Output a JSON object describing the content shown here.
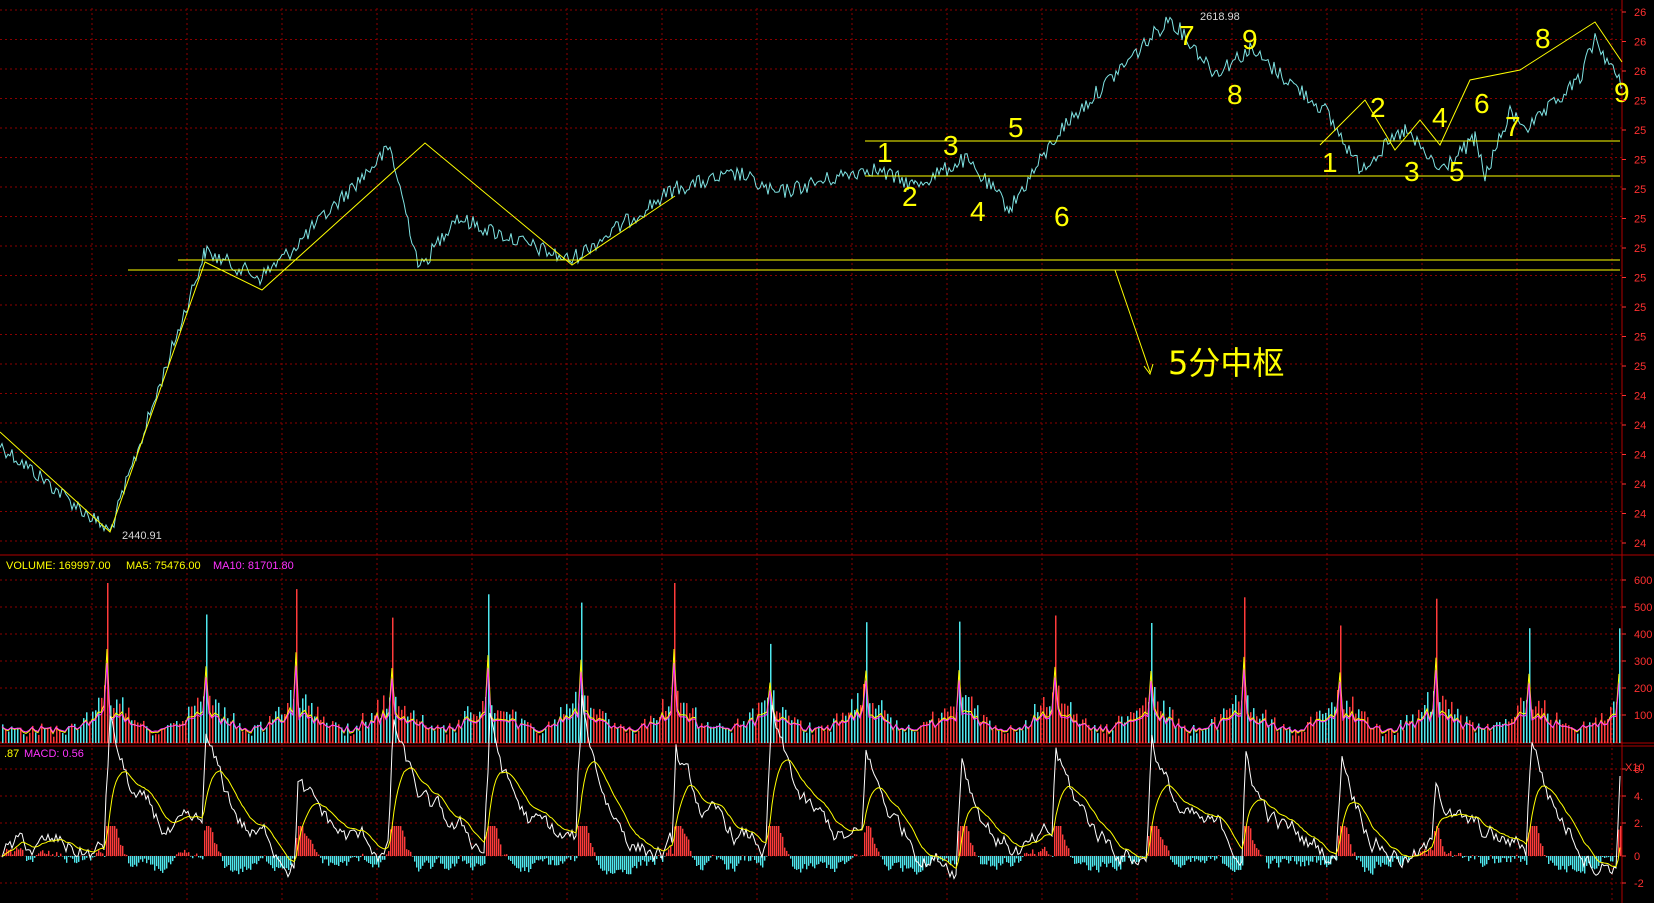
{
  "price_panel": {
    "y_tick_labels": [
      "26",
      "26",
      "26",
      "25",
      "25",
      "25",
      "25",
      "25",
      "25",
      "25",
      "25",
      "25",
      "25",
      "24",
      "24",
      "24",
      "24",
      "24",
      "24"
    ],
    "high_label": "2618.98",
    "low_label": "2440.91",
    "pivot_label": "5分中枢",
    "wave_labels": [
      "1",
      "2",
      "3",
      "4",
      "5",
      "6",
      "7",
      "8",
      "9",
      "1",
      "2",
      "3",
      "4",
      "5",
      "6",
      "7",
      "8",
      "9"
    ]
  },
  "volume_panel": {
    "volume_text": "VOLUME: 169997.00",
    "ma5_text": "MA5: 75476.00",
    "ma10_text": "MA10: 81701.80",
    "y_ticks": [
      "600",
      "500",
      "400",
      "300",
      "200",
      "100"
    ],
    "unit_label": "X10"
  },
  "macd_panel": {
    "left_value_text": ".87",
    "macd_text": "MACD: 0.56",
    "y_ticks": [
      "6.",
      "4.",
      "2.",
      "0",
      "-2"
    ]
  },
  "colors": {
    "background": "#000000",
    "grid": "#8b0000",
    "price_line": "#7fe3e3",
    "annotation": "#ffff00",
    "volume_up": "#ff3b3b",
    "volume_down": "#4fe8ee",
    "ma5": "#ffff00",
    "ma10": "#ff33ff",
    "axis_text": "#ff3030"
  },
  "chart_data": {
    "type": "line",
    "title": "",
    "y_range_panel": [
      2440.91,
      2618.98
    ],
    "price_extremes": {
      "high": 2618.98,
      "low": 2440.91
    },
    "price_pivots": [
      2471,
      2440.91,
      2538,
      2529,
      2538,
      2574,
      2532,
      2550,
      2535,
      2560,
      2565,
      2558,
      2567,
      2561,
      2570,
      2553,
      2580,
      2618.98,
      2600,
      2608,
      2587,
      2567,
      2580,
      2566,
      2577,
      2564,
      2586,
      2581,
      2598,
      2612,
      2595
    ],
    "volume": {
      "last": 169997.0,
      "ma5": 75476.0,
      "ma10": 81701.8
    },
    "macd": {
      "macd": 0.56
    }
  }
}
